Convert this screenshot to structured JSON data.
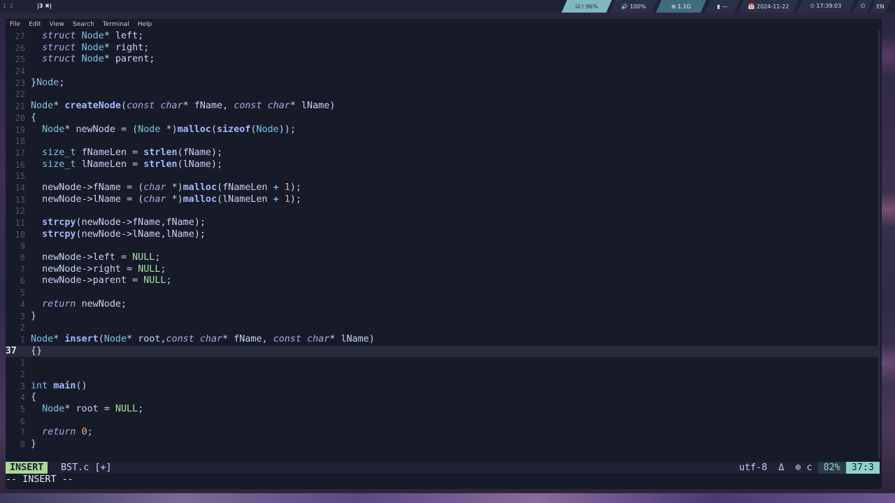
{
  "topbar": {
    "workspaces": [
      "1",
      "2",
      "3"
    ],
    "active_workspace_label": "|3 ✖|",
    "disk": "⛁ / 96%",
    "volume": "🔊 100%",
    "memory": "⊚ 1.1G",
    "battery": "▮ —",
    "date": "📅 2024-11-22",
    "time": "⏲ 17:39:03",
    "power_icon": "⏻",
    "lang": "EN"
  },
  "menu": {
    "items": [
      "File",
      "Edit",
      "View",
      "Search",
      "Terminal",
      "Help"
    ]
  },
  "editor": {
    "lines": [
      {
        "ln": "27"
      },
      {
        "ln": "26"
      },
      {
        "ln": "25"
      },
      {
        "ln": "24"
      },
      {
        "ln": "23"
      },
      {
        "ln": "22"
      },
      {
        "ln": "21"
      },
      {
        "ln": "20"
      },
      {
        "ln": "19"
      },
      {
        "ln": "18"
      },
      {
        "ln": "17"
      },
      {
        "ln": "16"
      },
      {
        "ln": "15"
      },
      {
        "ln": "14"
      },
      {
        "ln": "13"
      },
      {
        "ln": "12"
      },
      {
        "ln": "11"
      },
      {
        "ln": "10"
      },
      {
        "ln": "9"
      },
      {
        "ln": "8"
      },
      {
        "ln": "7"
      },
      {
        "ln": "6"
      },
      {
        "ln": "5"
      },
      {
        "ln": "4"
      },
      {
        "ln": "3"
      },
      {
        "ln": "2"
      },
      {
        "ln": "1"
      },
      {
        "ln": "37"
      },
      {
        "ln": "1"
      },
      {
        "ln": "2"
      },
      {
        "ln": "3"
      },
      {
        "ln": "4"
      },
      {
        "ln": "5"
      },
      {
        "ln": "6"
      },
      {
        "ln": "7"
      },
      {
        "ln": "8"
      }
    ],
    "code": [
      "  struct Node* left;",
      "  struct Node* right;",
      "  struct Node* parent;",
      "",
      "}Node;",
      "",
      "Node* createNode(const char* fName, const char* lName)",
      "{",
      "  Node* newNode = (Node *)malloc(sizeof(Node));",
      "",
      "  size_t fNameLen = strlen(fName);",
      "  size_t lNameLen = strlen(lName);",
      "",
      "  newNode->fName = (char *)malloc(fNameLen + 1);",
      "  newNode->lName = (char *)malloc(lNameLen + 1);",
      "",
      "  strcpy(newNode->fName,fName);",
      "  strcpy(newNode->lName,lName);",
      "",
      "  newNode->left = NULL;",
      "  newNode->right = NULL;",
      "  newNode->parent = NULL;",
      "",
      "  return newNode;",
      "}",
      "",
      "Node* insert(Node* root,const char* fName, const char* lName)",
      "{}",
      "",
      "",
      "int main()",
      "{",
      "  Node* root = NULL;",
      "",
      "  return 0;",
      "}"
    ],
    "current_line_index": 27
  },
  "statusline": {
    "mode": "INSERT",
    "file": "BST.c [+]",
    "encoding": "utf-8",
    "os_icon": "Δ",
    "filetype": "⊚ c",
    "percent": "82%",
    "position": "37:3"
  },
  "cmdline": "-- INSERT --",
  "colors": {
    "mode_bg": "#a6da95",
    "position_bg": "#8bd5ca",
    "background": "#161a29"
  }
}
